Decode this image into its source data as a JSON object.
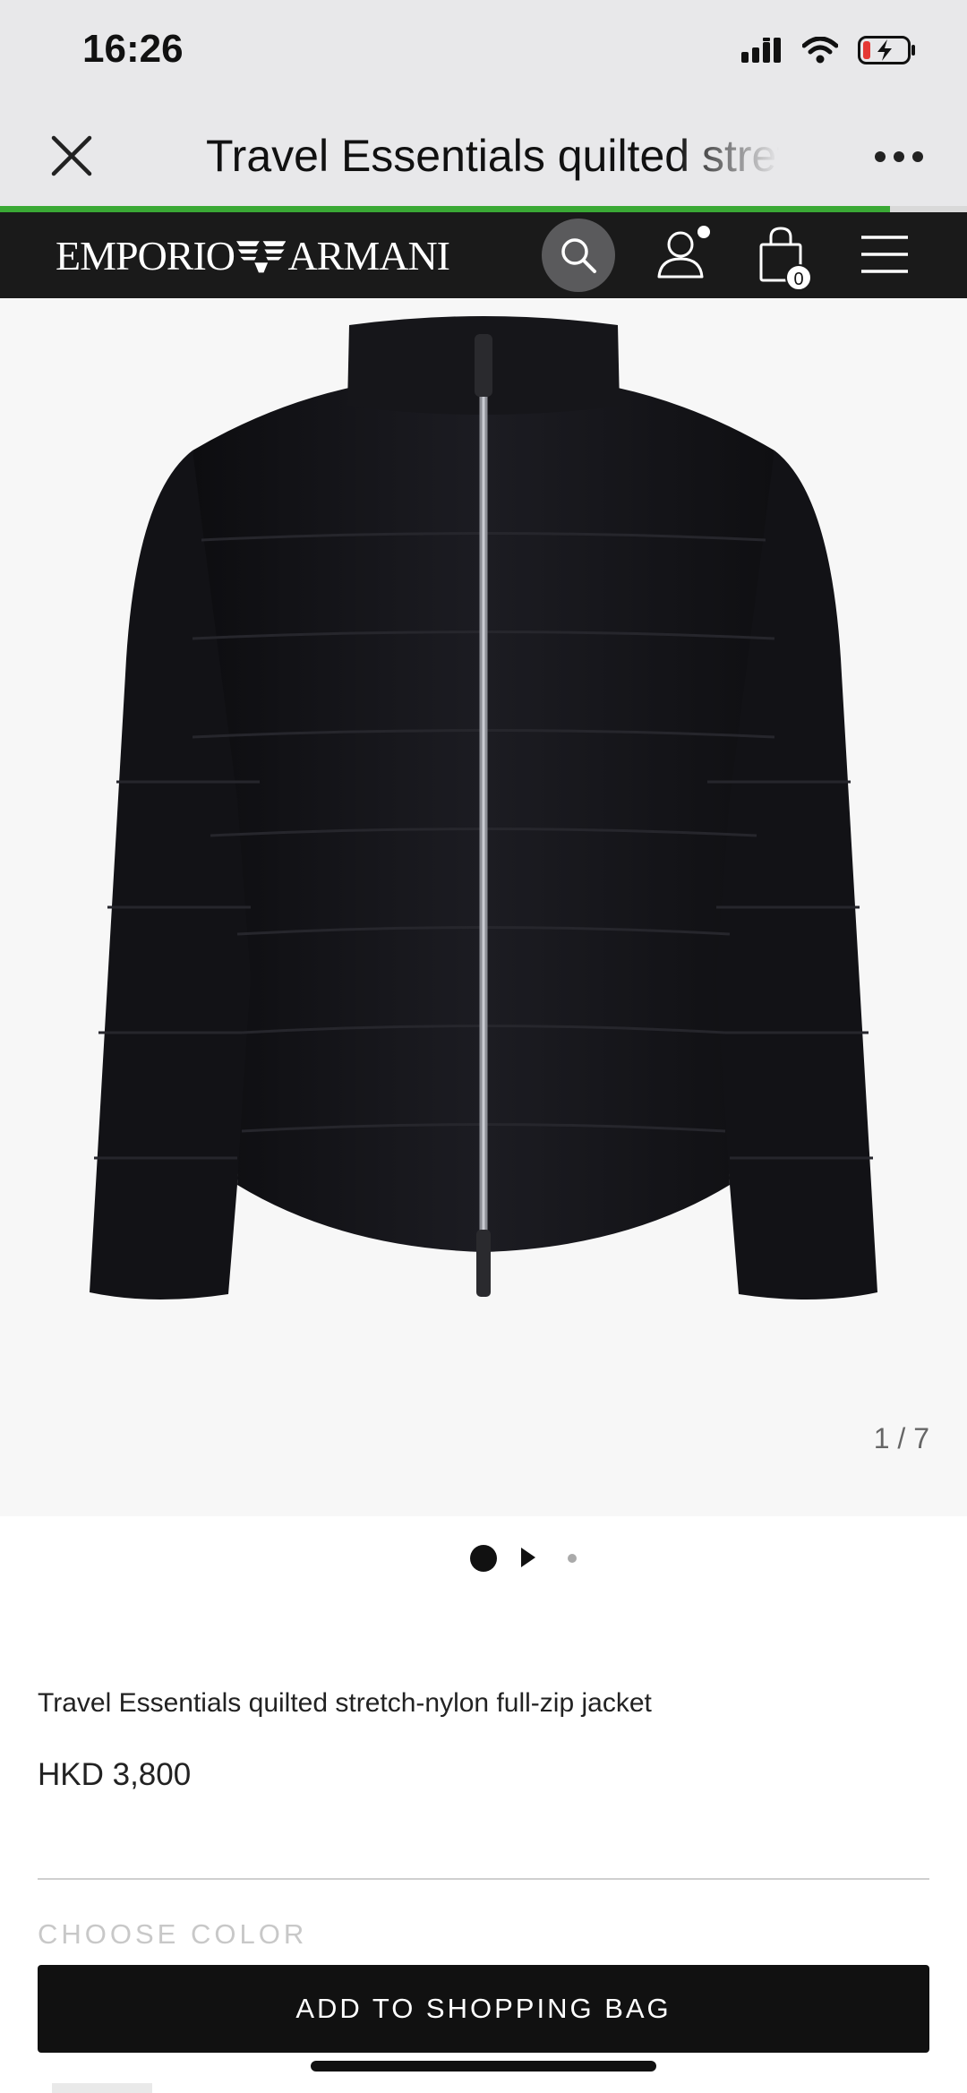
{
  "status_bar": {
    "time": "16:26",
    "icons": [
      "signal-icon",
      "wifi-icon",
      "battery-charging-icon"
    ]
  },
  "browser": {
    "title": "Travel Essentials quilted stretch-nylon full-zip jacket",
    "load_progress": 0.92,
    "icons": {
      "close": "close-icon",
      "more": "more-dots-icon"
    }
  },
  "header": {
    "logo_text_left": "EMPORIO",
    "logo_text_right": "ARMANI",
    "bag_count": "0",
    "icons": [
      "search-icon",
      "account-icon",
      "shopping-bag-icon",
      "menu-icon"
    ]
  },
  "gallery": {
    "counter": "1 / 7"
  },
  "product": {
    "name": "Travel Essentials quilted stretch-nylon full-zip jacket",
    "price": "HKD 3,800"
  },
  "options": {
    "choose_color_label": "CHOOSE COLOR"
  },
  "cta": {
    "add_to_bag": "ADD TO SHOPPING BAG"
  },
  "colors": {
    "accent_green": "#3aa935",
    "header_bg": "#1a1a1a",
    "button_bg": "#111111"
  }
}
